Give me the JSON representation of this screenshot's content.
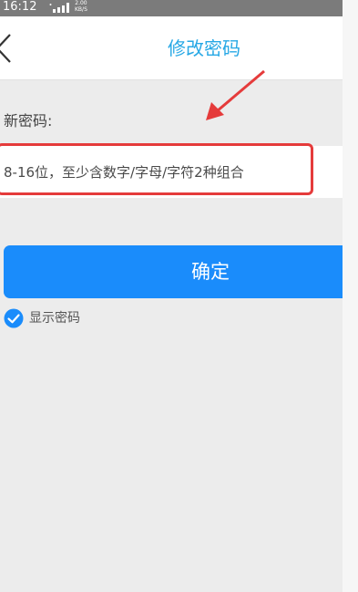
{
  "status_bar": {
    "time": "16:12",
    "net_speed_value": "2.00",
    "net_speed_unit": "KB/S"
  },
  "header": {
    "title": "修改密码",
    "back_icon": "chevron-left-icon"
  },
  "form": {
    "new_password_label": "新密码:",
    "new_password_value": "",
    "new_password_placeholder": "8-16位，至少含数字/字母/字符2种组合",
    "confirm_label": "确定",
    "show_password_label": "显示密码",
    "show_password_checked": true
  },
  "colors": {
    "accent": "#27a8e5",
    "button": "#1a8cfb",
    "annotation": "#e53b3b",
    "background": "#ececec"
  }
}
